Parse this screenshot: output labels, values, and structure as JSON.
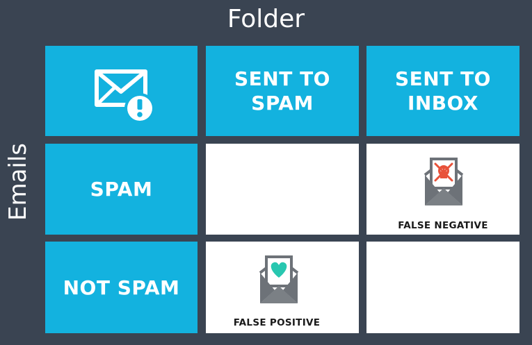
{
  "diagram": {
    "title": "Folder",
    "side_label": "Emails",
    "column_headers": [
      {
        "line1": "SENT TO",
        "line2": "SPAM"
      },
      {
        "line1": "SENT TO",
        "line2": "INBOX"
      }
    ],
    "row_headers": [
      "SPAM",
      "NOT SPAM"
    ],
    "cells": {
      "spam_inbox": "FALSE NEGATIVE",
      "notspam_spam": "FALSE POSITIVE"
    },
    "icons": {
      "corner": "mail-alert-icon",
      "false_negative": "mail-skull-icon",
      "false_positive": "mail-heart-icon"
    },
    "colors": {
      "background": "#3a4452",
      "cell_blue": "#13b2df",
      "cell_white": "#ffffff",
      "skull": "#e8523a",
      "heart": "#28c7b0",
      "envelope_gray": "#6d7278"
    }
  }
}
